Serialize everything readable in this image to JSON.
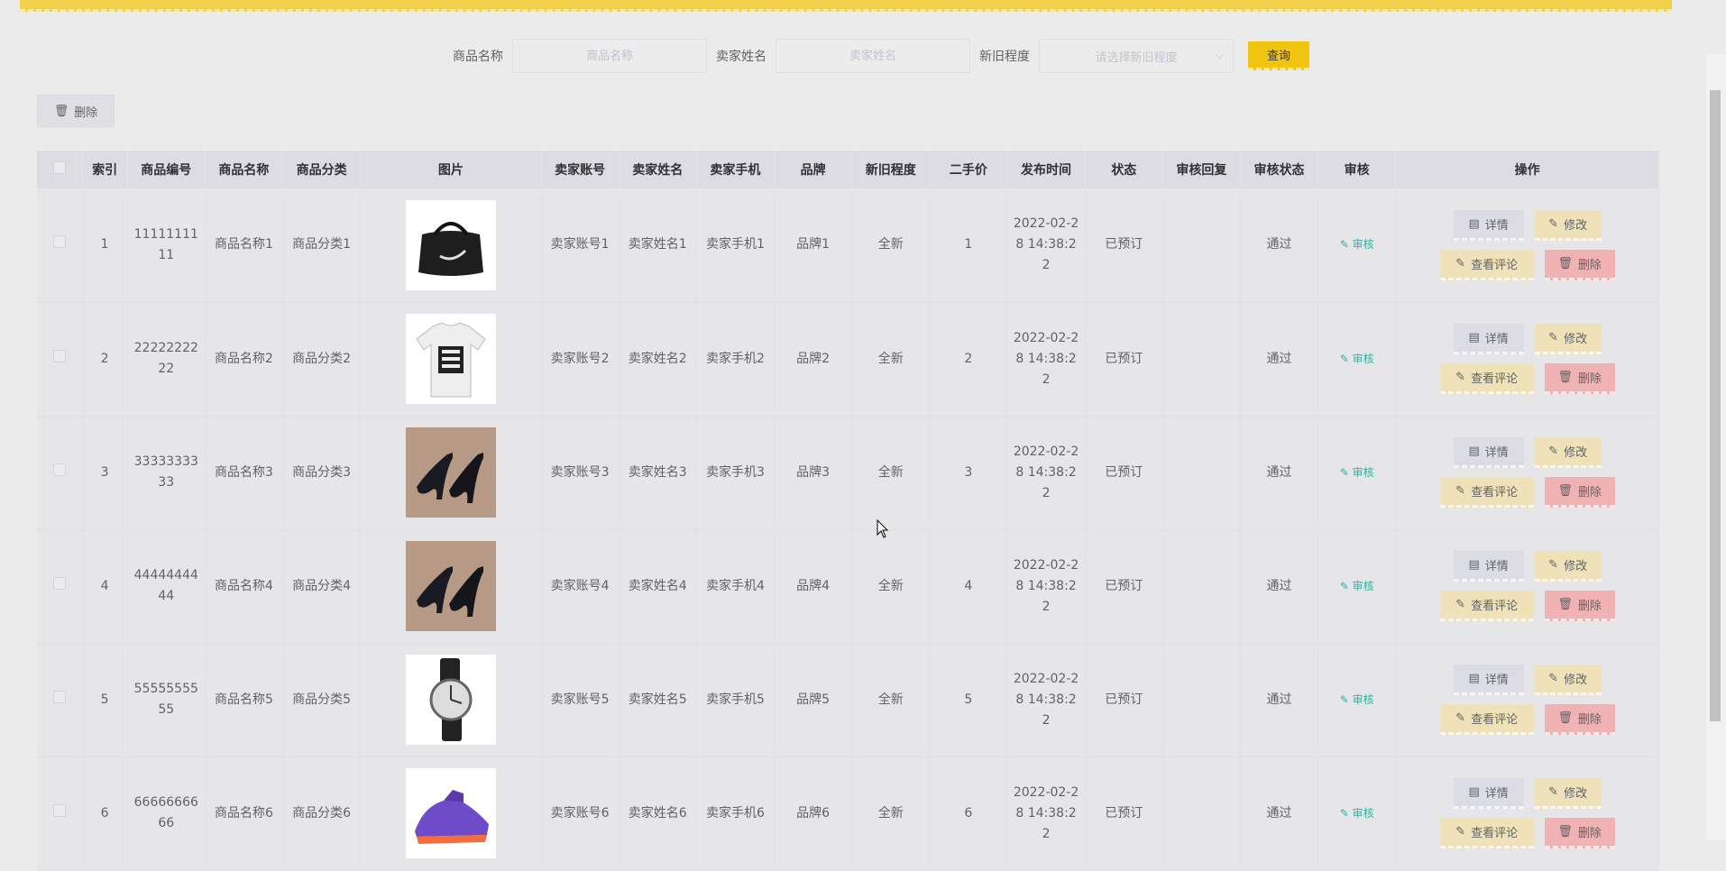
{
  "search": {
    "name_label": "商品名称",
    "name_placeholder": "商品名称",
    "seller_label": "卖家姓名",
    "seller_placeholder": "卖家姓名",
    "condition_label": "新旧程度",
    "condition_placeholder": "请选择新旧程度",
    "button": "查询"
  },
  "toolbar": {
    "delete_label": "删除"
  },
  "table": {
    "headers": [
      "索引",
      "商品编号",
      "商品名称",
      "商品分类",
      "图片",
      "卖家账号",
      "卖家姓名",
      "卖家手机",
      "品牌",
      "新旧程度",
      "二手价",
      "发布时间",
      "状态",
      "审核回复",
      "审核状态",
      "审核",
      "操作"
    ],
    "rows": [
      {
        "index": "1",
        "code": "1111111111",
        "name": "商品名称1",
        "category": "商品分类1",
        "image": "bag",
        "account": "卖家账号1",
        "seller": "卖家姓名1",
        "phone": "卖家手机1",
        "brand": "品牌1",
        "condition": "全新",
        "price": "1",
        "time": "2022-02-28 14:38:22",
        "status": "已预订",
        "reply": "",
        "audit_status": "通过",
        "audit": "审核"
      },
      {
        "index": "2",
        "code": "2222222222",
        "name": "商品名称2",
        "category": "商品分类2",
        "image": "tshirt",
        "account": "卖家账号2",
        "seller": "卖家姓名2",
        "phone": "卖家手机2",
        "brand": "品牌2",
        "condition": "全新",
        "price": "2",
        "time": "2022-02-28 14:38:22",
        "status": "已预订",
        "reply": "",
        "audit_status": "通过",
        "audit": "审核"
      },
      {
        "index": "3",
        "code": "3333333333",
        "name": "商品名称3",
        "category": "商品分类3",
        "image": "heels",
        "account": "卖家账号3",
        "seller": "卖家姓名3",
        "phone": "卖家手机3",
        "brand": "品牌3",
        "condition": "全新",
        "price": "3",
        "time": "2022-02-28 14:38:22",
        "status": "已预订",
        "reply": "",
        "audit_status": "通过",
        "audit": "审核"
      },
      {
        "index": "4",
        "code": "4444444444",
        "name": "商品名称4",
        "category": "商品分类4",
        "image": "heels",
        "account": "卖家账号4",
        "seller": "卖家姓名4",
        "phone": "卖家手机4",
        "brand": "品牌4",
        "condition": "全新",
        "price": "4",
        "time": "2022-02-28 14:38:22",
        "status": "已预订",
        "reply": "",
        "audit_status": "通过",
        "audit": "审核"
      },
      {
        "index": "5",
        "code": "5555555555",
        "name": "商品名称5",
        "category": "商品分类5",
        "image": "watch",
        "account": "卖家账号5",
        "seller": "卖家姓名5",
        "phone": "卖家手机5",
        "brand": "品牌5",
        "condition": "全新",
        "price": "5",
        "time": "2022-02-28 14:38:22",
        "status": "已预订",
        "reply": "",
        "audit_status": "通过",
        "audit": "审核"
      },
      {
        "index": "6",
        "code": "6666666666",
        "name": "商品名称6",
        "category": "商品分类6",
        "image": "sneaker",
        "account": "卖家账号6",
        "seller": "卖家姓名6",
        "phone": "卖家手机6",
        "brand": "品牌6",
        "condition": "全新",
        "price": "6",
        "time": "2022-02-28 14:38:22",
        "status": "已预订",
        "reply": "",
        "audit_status": "通过",
        "audit": "审核"
      }
    ],
    "actions": {
      "detail": "详情",
      "edit": "修改",
      "comments": "查看评论",
      "delete": "删除"
    }
  }
}
